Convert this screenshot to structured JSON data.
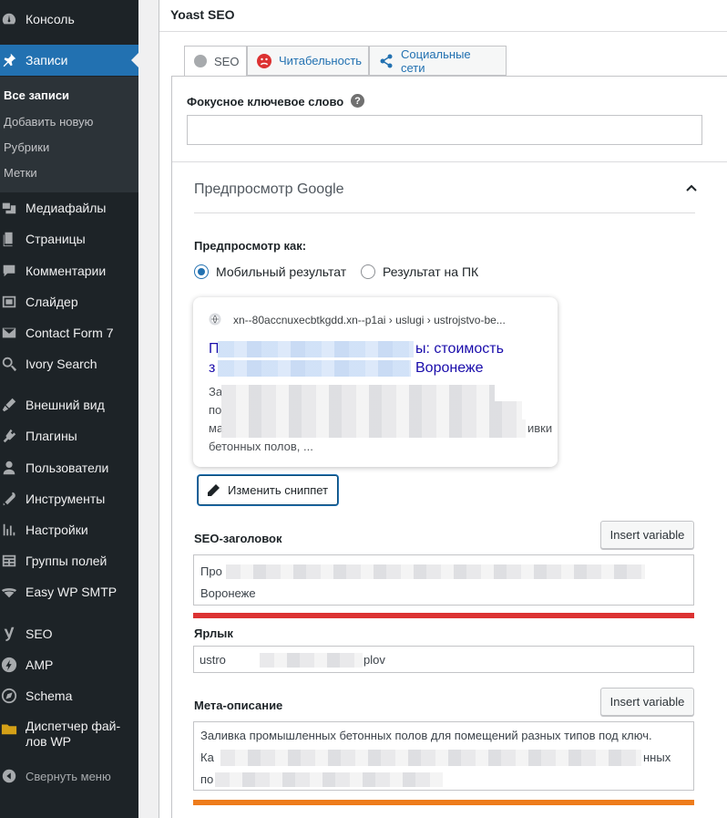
{
  "sidebar": {
    "items": [
      {
        "label": "Консоль",
        "icon": "dashboard-icon"
      },
      {
        "label": "Записи",
        "icon": "pin-icon"
      },
      {
        "label": "Медиафайлы",
        "icon": "media-icon"
      },
      {
        "label": "Страницы",
        "icon": "pages-icon"
      },
      {
        "label": "Комментарии",
        "icon": "comments-icon"
      },
      {
        "label": "Слайдер",
        "icon": "slider-icon"
      },
      {
        "label": "Contact Form 7",
        "icon": "mail-icon"
      },
      {
        "label": "Ivory Search",
        "icon": "search-icon"
      },
      {
        "label": "Внешний вид",
        "icon": "appearance-icon"
      },
      {
        "label": "Плагины",
        "icon": "plugins-icon"
      },
      {
        "label": "Пользователи",
        "icon": "users-icon"
      },
      {
        "label": "Инструменты",
        "icon": "tools-icon"
      },
      {
        "label": "Настройки",
        "icon": "settings-icon"
      },
      {
        "label": "Группы полей",
        "icon": "field-groups-icon"
      },
      {
        "label": "Easy WP SMTP",
        "icon": "smtp-icon"
      },
      {
        "label": "SEO",
        "icon": "yoast-icon"
      },
      {
        "label": "AMP",
        "icon": "amp-icon"
      },
      {
        "label": "Schema",
        "icon": "schema-icon"
      },
      {
        "label": "Диспетчер фай-",
        "label2": "лов WP",
        "icon": "file-manager-icon"
      }
    ],
    "submenu": [
      "Все записи",
      "Добавить новую",
      "Рубрики",
      "Метки"
    ],
    "collapse": "Свернуть меню"
  },
  "panel": {
    "title": "Yoast SEO",
    "tabs": [
      "SEO",
      "Читабельность",
      "Социальные сети"
    ],
    "focus_keyword_label": "Фокусное ключевое слово",
    "focus_keyword_value": "",
    "help": "?",
    "google_preview_title": "Предпросмотр Google",
    "preview_as_label": "Предпросмотр как:",
    "radio_mobile": "Мобильный результат",
    "radio_desktop": "Результат на ПК",
    "snippet": {
      "url": "xn--80accnuxecbtkgdd.xn--p1ai › uslugi › ustrojstvo-be...",
      "title_line1_end": "ы: стоимость",
      "title_line2_end": "Воронеже",
      "desc_l1_start": "За",
      "desc_l2_start": "по",
      "desc_l3_start": "ма",
      "desc_l3_end": "ивки",
      "desc_l4": "бетонных полов, ..."
    },
    "edit_snippet_label": "Изменить сниппет",
    "seo_title_label": "SEO-заголовок",
    "insert_variable": "Insert variable",
    "seo_title_l1_start": "Про",
    "seo_title_l2": "Воронеже",
    "slug_label": "Ярлык",
    "slug_start": "ustro",
    "slug_end": "plov",
    "meta_label": "Мета-описание",
    "meta_l1": "Заливка промышленных бетонных полов для помещений разных типов под ключ.",
    "meta_l2_start": "Ка",
    "meta_l2_end": "нных",
    "meta_l3_start": "по"
  },
  "colors": {
    "sidebar_bg": "#1d2327",
    "active_bg": "#2271b1",
    "seo_title_bar": "#dc3232",
    "meta_bar": "#ee7c1b"
  }
}
